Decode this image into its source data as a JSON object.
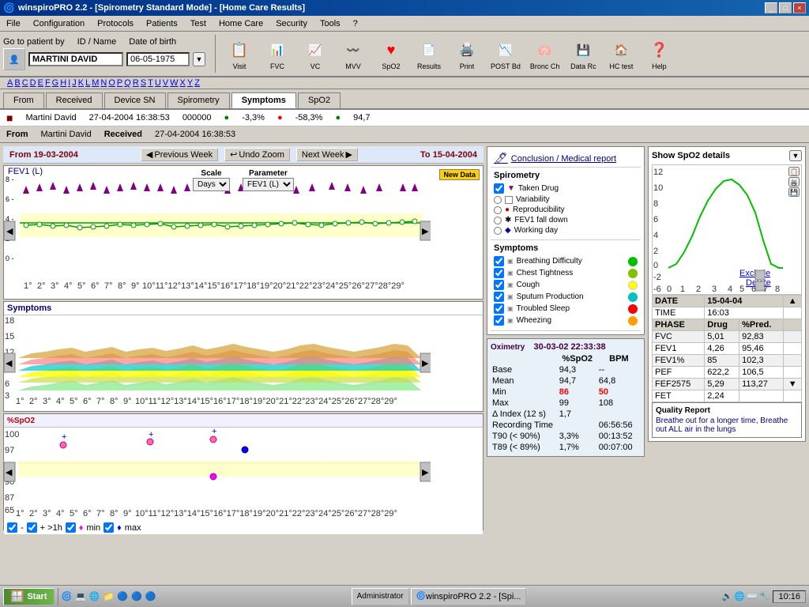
{
  "window": {
    "title": "winspiroPRO 2.2 - [Spirometry Standard Mode] - [Home Care Results]",
    "title_short": "winspiroPRO 2.2 - [Spi..."
  },
  "menu": {
    "items": [
      "File",
      "Configuration",
      "Protocols",
      "Patients",
      "Test",
      "Home Care",
      "Security",
      "Tools",
      "?"
    ]
  },
  "toolbar": {
    "patient_label": "Go to patient by",
    "id_label": "ID / Name",
    "dob_label": "Date of birth",
    "patient_name": "MARTINI DAVID",
    "dob": "06-05-1975",
    "buttons": [
      {
        "label": "Patient",
        "icon": "👤"
      },
      {
        "label": "Visit",
        "icon": "📋"
      },
      {
        "label": "FVC",
        "icon": "📊"
      },
      {
        "label": "VC",
        "icon": "📈"
      },
      {
        "label": "MVV",
        "icon": "〰️"
      },
      {
        "label": "SpO2",
        "icon": "❤️"
      },
      {
        "label": "Results",
        "icon": "📄"
      },
      {
        "label": "Print",
        "icon": "🖨️"
      },
      {
        "label": "POST Bd",
        "icon": "📉"
      },
      {
        "label": "Bronc Ch",
        "icon": "🫁"
      },
      {
        "label": "Data Rc",
        "icon": "💾"
      },
      {
        "label": "HC test",
        "icon": "🏠"
      },
      {
        "label": "Help",
        "icon": "❓"
      }
    ]
  },
  "alphabet": "A B C D E F G H I J K L M N O P Q R S T U V W X Y Z",
  "tabs": {
    "items": [
      "From",
      "Received",
      "Device SN",
      "Spirometry",
      "Symptoms",
      "SpO2"
    ]
  },
  "data_row": {
    "name": "Martini David",
    "date": "27-04-2004 16:38:53",
    "device": "000000",
    "spirometry": "-3,3%",
    "symptoms": "-58,3%",
    "spo2": "94,7"
  },
  "from_bar": {
    "from_label": "From",
    "from_name": "Martini David",
    "received_label": "Received",
    "received_date": "27-04-2004 16:38:53"
  },
  "chart": {
    "from_date": "From 19-03-2004",
    "to_date": "To 15-04-2004",
    "prev_week": "Previous Week",
    "next_week": "Next Week",
    "undo_zoom": "Undo Zoom",
    "new_data": "New Data",
    "scale_label": "Scale",
    "scale_value": "Days",
    "param_label": "Parameter",
    "param_value": "FEV1 (L)",
    "y_axis_label": "FEV1 (L)",
    "x_labels": [
      "1°",
      "2°",
      "3°",
      "4°",
      "5°",
      "6°",
      "7°",
      "8°",
      "9°",
      "10°11°12°13°14°15°16°17°18°19°20°21°22°23°24°25°26°27°28°29°"
    ]
  },
  "legend": {
    "conclusion_label": "Conclusion / Medical report",
    "spirometry_title": "Spirometry",
    "taken_drug": "Taken Drug",
    "spirometry_items": [
      {
        "label": "Variability"
      },
      {
        "label": "Reproducibility"
      },
      {
        "label": "FEV1 fall down"
      },
      {
        "label": "Working day"
      }
    ],
    "symptoms_title": "Symptoms",
    "symptom_items": [
      {
        "label": "Breathing Difficulty",
        "color": "#00c000"
      },
      {
        "label": "Chest Tightness",
        "color": "#80c000"
      },
      {
        "label": "Cough",
        "color": "#ffff00"
      },
      {
        "label": "Sputum Production",
        "color": "#00c0c0"
      },
      {
        "label": "Troubled Sleep",
        "color": "#ff0000"
      },
      {
        "label": "Wheezing",
        "color": "#ffa000"
      }
    ]
  },
  "oximetry": {
    "title": "Oximetry",
    "datetime": "30-03-02 22:33:38",
    "col1": "%SpO2",
    "col2": "BPM",
    "rows": [
      {
        "label": "Base",
        "spo2": "94,3",
        "bpm": "--"
      },
      {
        "label": "Mean",
        "spo2": "94,7",
        "bpm": "64,8"
      },
      {
        "label": "Min",
        "spo2": "86",
        "bpm": "50",
        "highlight": true
      },
      {
        "label": "Max",
        "spo2": "99",
        "bpm": "108"
      },
      {
        "label": "Δ Index (12 s)",
        "spo2": "1,7",
        "bpm": ""
      }
    ],
    "recording_time_label": "Recording Time",
    "recording_time": "06:56:56",
    "t90_label": "T90 (< 90%)",
    "t90_pct": "3,3%",
    "t90_time": "00:13:52",
    "t89_label": "T89 (< 89%)",
    "t89_pct": "1,7%",
    "t89_time": "00:07:00"
  },
  "spo2_detail": {
    "title": "Show SpO2 details",
    "date_label": "DATE",
    "date_value": "15-04-04",
    "time_label": "TIME",
    "time_value": "16:03",
    "phase_label": "PHASE",
    "drug_label": "Drug",
    "pred_label": "%Pred.",
    "measurements": [
      {
        "param": "FVC",
        "drug": "5,01",
        "pred": "92,83"
      },
      {
        "param": "FEV1",
        "drug": "4,26",
        "pred": "95,46"
      },
      {
        "param": "FEV1%",
        "drug": "85",
        "pred": "102,3"
      },
      {
        "param": "PEF",
        "drug": "622,2",
        "pred": "106,5"
      },
      {
        "param": "FEF2575",
        "drug": "5,29",
        "pred": "113,27"
      },
      {
        "param": "FET",
        "drug": "2,24",
        "pred": ""
      }
    ],
    "quality_report_title": "Quality Report",
    "quality_text": "Breathe out for a longer time, Breathe out ALL air in the lungs"
  },
  "spo2_chart": {
    "y_max": 100,
    "y_min": 65,
    "label": "%SpO2"
  },
  "taskbar": {
    "start": "Start",
    "items": [
      "Administrator",
      "winspiroPRO 2.2 - [Spi..."
    ],
    "time": "10:16"
  }
}
